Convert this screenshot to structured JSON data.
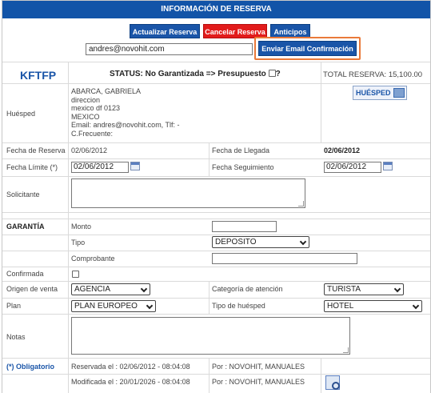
{
  "header": {
    "title": "INFORMACIÓN DE RESERVA"
  },
  "toolbar": {
    "update_label": "Actualizar Reserva",
    "cancel_label": "Cancelar Reserva",
    "advances_label": "Anticipos",
    "email_value": "andres@novohit.com",
    "send_email_label": "Enviar Email Confirmación"
  },
  "reservation": {
    "code": "KFTFP",
    "status": "STATUS: No Garantizada => Presupuesto",
    "status_suffix": "?",
    "total": "TOTAL RESERVA: 15,100.00"
  },
  "guest": {
    "label": "Huésped",
    "lines": [
      "ABARCA, GABRIELA",
      "direccion",
      "mexico df 0123",
      "MEXICO",
      "Email: andres@novohit.com, Tlf: -",
      "C.Frecuente:"
    ],
    "badge": "HUÉSPED"
  },
  "dates": {
    "booking_label": "Fecha de Reserva",
    "booking_value": "02/06/2012",
    "arrival_label": "Fecha de Llegada",
    "arrival_value": "02/06/2012",
    "limit_label": "Fecha Límite (*)",
    "limit_value": "02/06/2012",
    "followup_label": "Fecha Seguimiento",
    "followup_value": "02/06/2012"
  },
  "requester": {
    "label": "Solicitante"
  },
  "guarantee": {
    "label": "GARANTÍA",
    "amount_label": "Monto",
    "type_label": "Tipo",
    "type_value": "DEPOSITO",
    "voucher_label": "Comprobante"
  },
  "confirmed": {
    "label": "Confirmada"
  },
  "sale_origin": {
    "label": "Origen de venta",
    "value": "AGENCIA"
  },
  "attention": {
    "label": "Categoría de atención",
    "value": "TURISTA"
  },
  "plan": {
    "label": "Plan",
    "value": "PLAN EUROPEO"
  },
  "guest_type": {
    "label": "Tipo de huésped",
    "value": "HOTEL"
  },
  "notes": {
    "label": "Notas"
  },
  "footer": {
    "required": "(*) Obligatorio",
    "reserved": "Reservada el : 02/06/2012 - 08:04:08",
    "reserved_by": "Por : NOVOHIT, MANUALES",
    "modified": "Modificada el : 20/01/2026 - 08:04:08",
    "modified_by": "Por : NOVOHIT, MANUALES"
  }
}
